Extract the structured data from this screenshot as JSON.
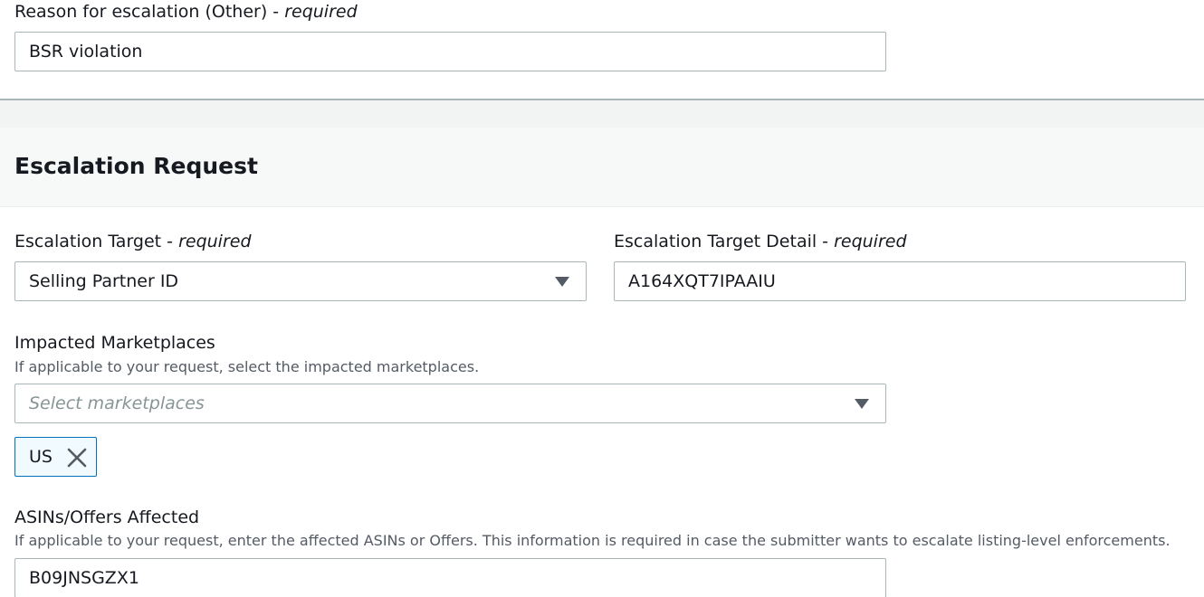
{
  "reason": {
    "label": "Reason for escalation (Other)",
    "required_text": "required",
    "value": "BSR violation"
  },
  "section": {
    "title": "Escalation Request"
  },
  "escalation_target": {
    "label": "Escalation Target",
    "required_text": "required",
    "selected": "Selling Partner ID"
  },
  "escalation_target_detail": {
    "label": "Escalation Target Detail",
    "required_text": "required",
    "value": "A164XQT7IPAAIU"
  },
  "marketplaces": {
    "label": "Impacted Marketplaces",
    "hint": "If applicable to your request, select the impacted marketplaces.",
    "placeholder": "Select marketplaces",
    "tokens": [
      "US"
    ]
  },
  "asins": {
    "label": "ASINs/Offers Affected",
    "hint": "If applicable to your request, enter the affected ASINs or Offers. This information is required in case the submitter wants to escalate listing-level enforcements.",
    "value": "B09JNSGZX1"
  },
  "icons": {
    "dropdown": "caret-down-icon",
    "remove": "close-icon"
  },
  "colors": {
    "text": "#16191f",
    "secondary_text": "#545b64",
    "border": "#aab7b8",
    "token_border": "#0073bb",
    "token_bg": "#f1faff"
  }
}
